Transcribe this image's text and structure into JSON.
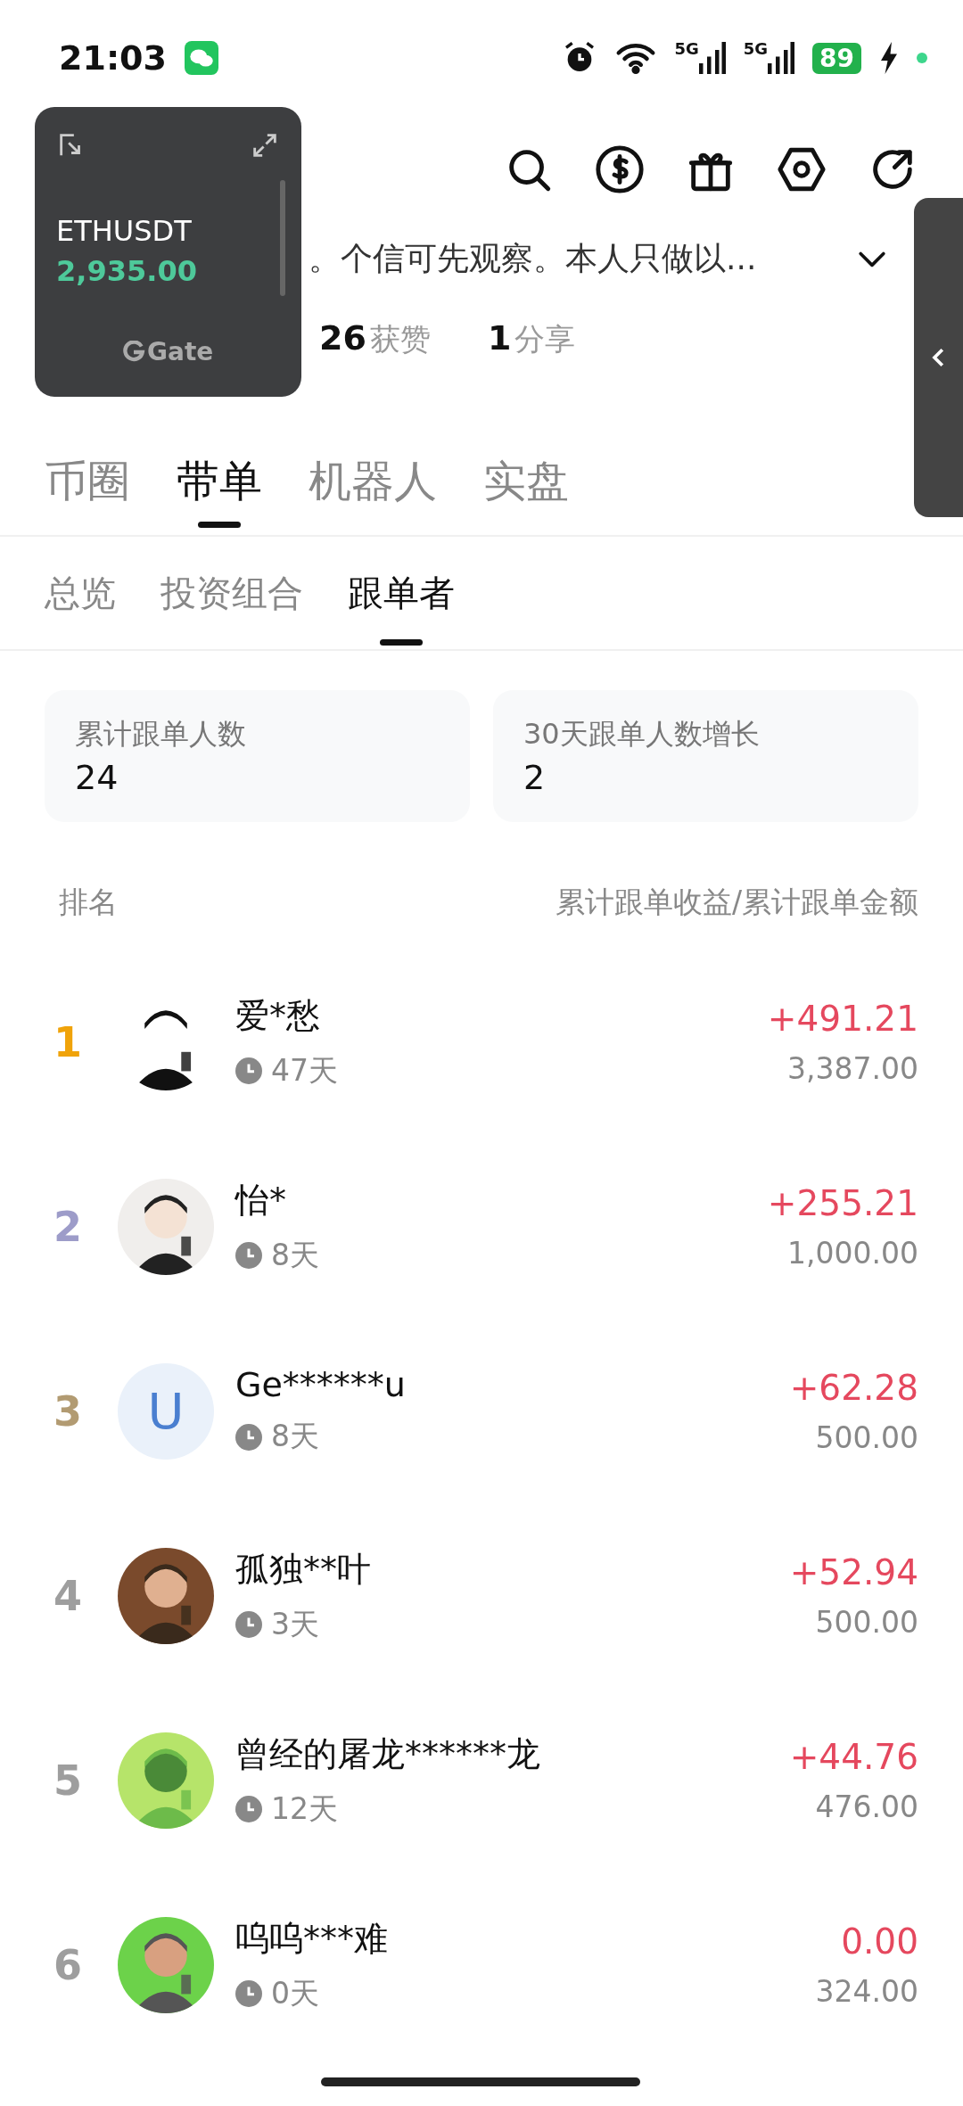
{
  "status_bar": {
    "time": "21:03",
    "networks": [
      "5G",
      "5G"
    ],
    "battery": "89"
  },
  "floating_widget": {
    "symbol": "ETHUSDT",
    "price": "2,935.00",
    "brand": "Gate"
  },
  "header": {
    "bio": "。个信可先观察。本人只做以...",
    "stats": [
      {
        "value": "26",
        "label": "获赞"
      },
      {
        "value": "1",
        "label": "分享"
      }
    ]
  },
  "tabs": [
    {
      "label": "币圈",
      "selected": false
    },
    {
      "label": "带单",
      "selected": true
    },
    {
      "label": "机器人",
      "selected": false
    },
    {
      "label": "实盘",
      "selected": false
    }
  ],
  "subtabs": [
    {
      "label": "总览",
      "selected": false
    },
    {
      "label": "投资组合",
      "selected": false
    },
    {
      "label": "跟单者",
      "selected": true
    }
  ],
  "summary": [
    {
      "label": "累计跟单人数",
      "value": "24"
    },
    {
      "label": "30天跟单人数增长",
      "value": "2"
    }
  ],
  "list_header": {
    "rank": "排名",
    "value": "累计跟单收益/累计跟单金额"
  },
  "followers": [
    {
      "rank": "1",
      "color": "#f0a30a",
      "name": "爱*愁",
      "days": "47天",
      "profit": "+491.21",
      "amount": "3,387.00"
    },
    {
      "rank": "2",
      "color": "#9d9cc9",
      "name": "怡*",
      "days": "8天",
      "profit": "+255.21",
      "amount": "1,000.00"
    },
    {
      "rank": "3",
      "color": "#b29b72",
      "name": "Ge******u",
      "days": "8天",
      "profit": "+62.28",
      "amount": "500.00",
      "avatar": {
        "kind": "letter",
        "letter": "U"
      }
    },
    {
      "rank": "4",
      "color": "#9e9e9e",
      "name": "孤独**叶",
      "days": "3天",
      "profit": "+52.94",
      "amount": "500.00"
    },
    {
      "rank": "5",
      "color": "#9e9e9e",
      "name": "曾经的屠龙******龙",
      "days": "12天",
      "profit": "+44.76",
      "amount": "476.00"
    },
    {
      "rank": "6",
      "color": "#9e9e9e",
      "name": "呜呜***难",
      "days": "0天",
      "profit": "0.00",
      "amount": "324.00"
    }
  ]
}
